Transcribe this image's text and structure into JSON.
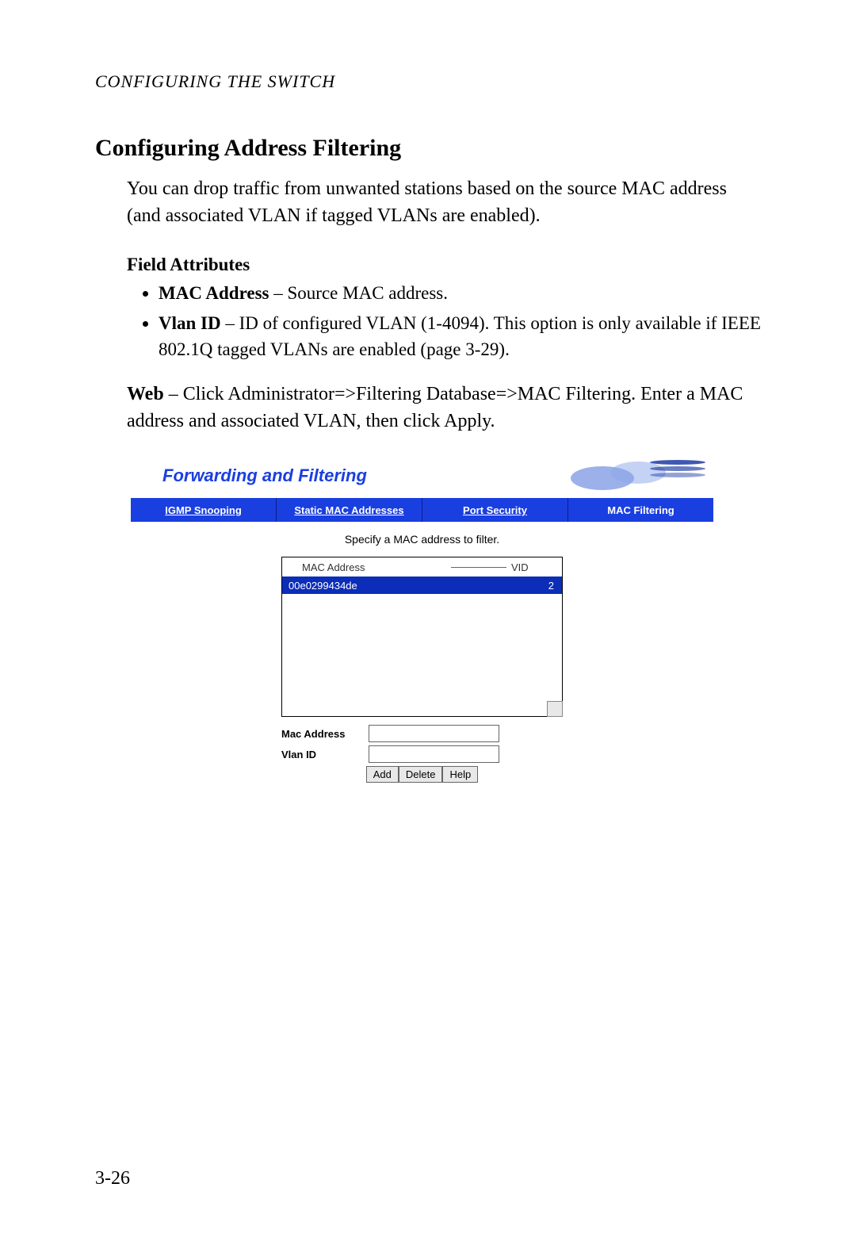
{
  "running_head": "CONFIGURING THE SWITCH",
  "section_title": "Configuring Address Filtering",
  "intro_para": "You can drop traffic from unwanted stations based on the source MAC address (and associated VLAN if tagged VLANs are enabled).",
  "field_attributes_heading": "Field Attributes",
  "attrs": {
    "mac_label": "MAC Address",
    "mac_desc": " – Source MAC address.",
    "vlan_label": "Vlan ID",
    "vlan_desc": " – ID of configured VLAN (1-4094). This option is only available if IEEE 802.1Q tagged VLANs are enabled (page 3-29)."
  },
  "web_label": "Web",
  "web_text": " – Click Administrator=>Filtering Database=>MAC Filtering. Enter a MAC address and associated VLAN, then click Apply.",
  "page_number": "3-26",
  "screenshot": {
    "title": "Forwarding and Filtering",
    "tabs": {
      "igmp": "IGMP Snooping",
      "static": "Static MAC Addresses",
      "port_sec": "Port Security",
      "mac_filt": "MAC Filtering"
    },
    "instruction": "Specify a MAC address to filter.",
    "list_header_mac": "MAC Address",
    "list_header_vid": "VID",
    "row_mac": "00e0299434de",
    "row_vid": "2",
    "form_mac_label": "Mac Address",
    "form_vlan_label": "Vlan ID",
    "mac_input_value": "",
    "vlan_input_value": "",
    "buttons": {
      "add": "Add",
      "delete": "Delete",
      "help": "Help"
    }
  }
}
